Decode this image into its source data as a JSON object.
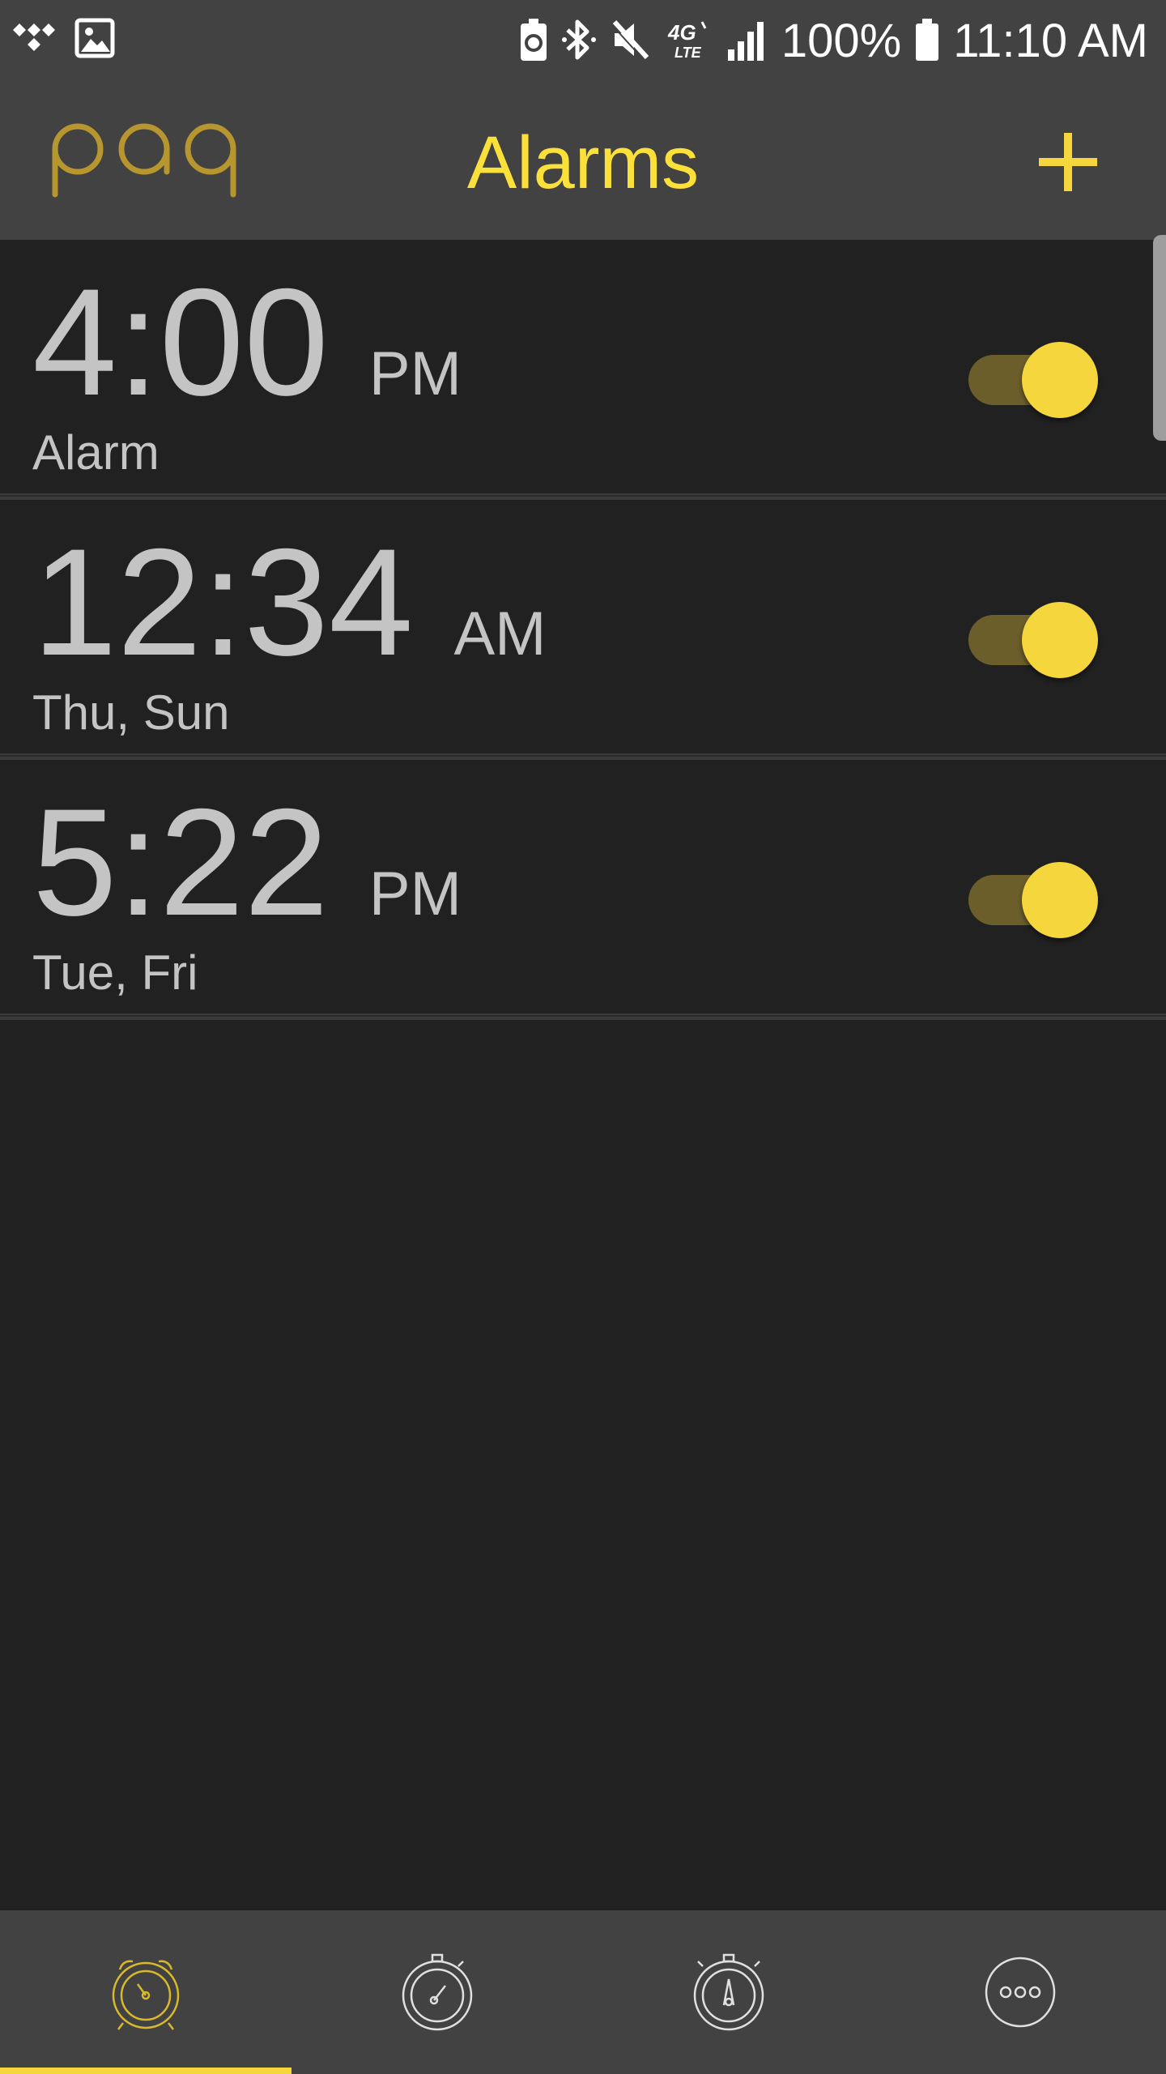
{
  "status_bar": {
    "battery_percent": "100%",
    "clock": "11:10 AM",
    "left_icons": [
      "tidal-icon",
      "image-icon"
    ],
    "right_icons": [
      "battery-saver-icon",
      "bluetooth-icon",
      "mute-icon",
      "4g-lte-icon",
      "signal-icon",
      "battery-icon"
    ]
  },
  "app_bar": {
    "logo_text": "paq",
    "title": "Alarms",
    "add_icon": "plus-icon"
  },
  "alarms": [
    {
      "time": "4:00",
      "ampm": "PM",
      "label": "Alarm",
      "enabled": true
    },
    {
      "time": "12:34",
      "ampm": "AM",
      "label": "Thu, Sun",
      "enabled": true
    },
    {
      "time": "5:22",
      "ampm": "PM",
      "label": "Tue, Fri",
      "enabled": true
    }
  ],
  "bottom_nav": {
    "items": [
      {
        "icon": "alarm-clock-icon",
        "active": true
      },
      {
        "icon": "timer-icon",
        "active": false
      },
      {
        "icon": "stopwatch-icon",
        "active": false
      },
      {
        "icon": "more-icon",
        "active": false
      }
    ]
  },
  "colors": {
    "accent": "#F5D63D",
    "title": "#FBE03A",
    "background": "#212121",
    "bars": "#424242",
    "text": "#C4C4C4"
  }
}
